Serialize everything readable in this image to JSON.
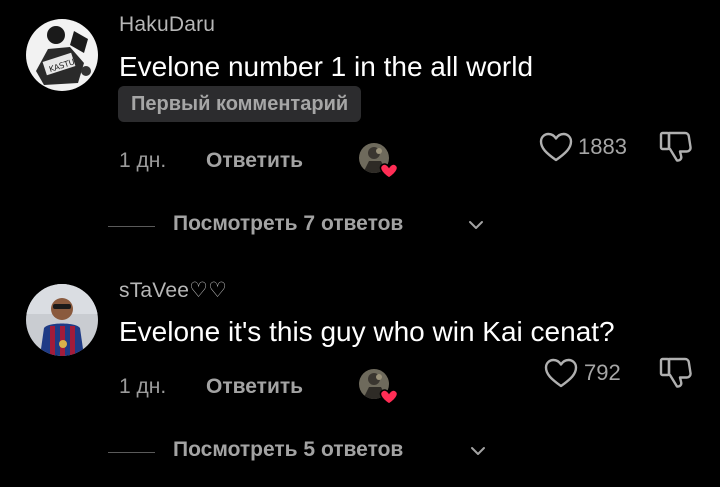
{
  "comments": [
    {
      "username": "HakuDaru",
      "text": "Evelone number 1 in the all world",
      "badge": "Первый комментарий",
      "time": "1 дн.",
      "reply_label": "Ответить",
      "likes": "1883",
      "view_replies": "Посмотреть 7 ответов"
    },
    {
      "username": "sTaVee♡♡",
      "text": "Evelone it's this guy who win Kai cenat?",
      "time": "1 дн.",
      "reply_label": "Ответить",
      "likes": "792",
      "view_replies": "Посмотреть 5 ответов"
    }
  ],
  "colors": {
    "background": "#000000",
    "username": "#b7b7b7",
    "muted": "#a3a3a3",
    "badge_bg": "#2c2c2e",
    "heart": "#ff2d55"
  },
  "icons": {
    "like": "heart-outline-icon",
    "dislike": "thumbs-down-icon",
    "creator_liked": "creator-liked-heart-icon",
    "expand": "chevron-down-icon"
  }
}
